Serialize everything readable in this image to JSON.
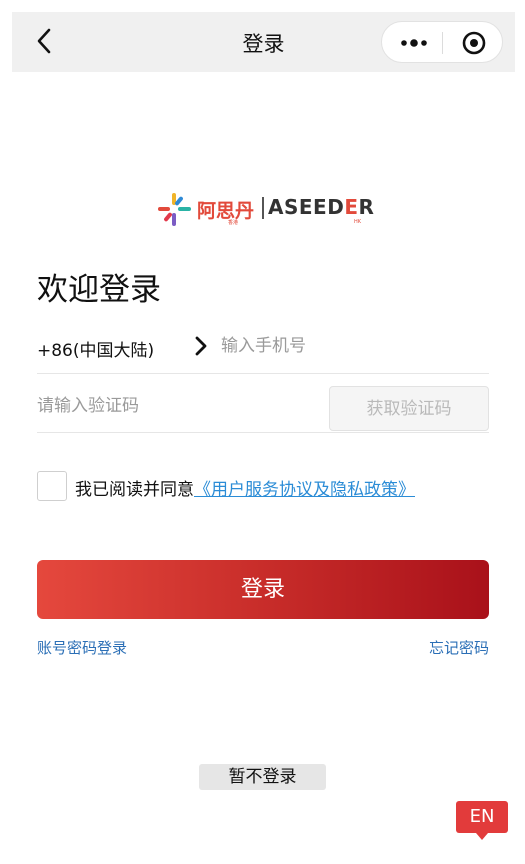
{
  "nav": {
    "title": "登录"
  },
  "logo": {
    "cn": "阿思丹",
    "sub": "香港",
    "en_prefix": "ASEED",
    "en_accent": "E",
    "en_suffix": "R",
    "hk": "HK"
  },
  "welcome": "欢迎登录",
  "phone": {
    "country_code": "+86(中国大陆)",
    "placeholder": "输入手机号",
    "value": ""
  },
  "code": {
    "placeholder": "请输入验证码",
    "value": "",
    "get_code_label": "获取验证码"
  },
  "agreement": {
    "prefix": "我已阅读并同意",
    "link": "《用户服务协议及隐私政策》",
    "checked": false
  },
  "login_button": "登录",
  "links": {
    "password_login": "账号密码登录",
    "forgot_password": "忘记密码"
  },
  "skip_button": "暂不登录",
  "language_button": "EN",
  "colors": {
    "brand_red": "#e24a3b",
    "link_blue": "#2b8cd6",
    "button_gradient_start": "#e5483d",
    "button_gradient_end": "#a9111a"
  }
}
